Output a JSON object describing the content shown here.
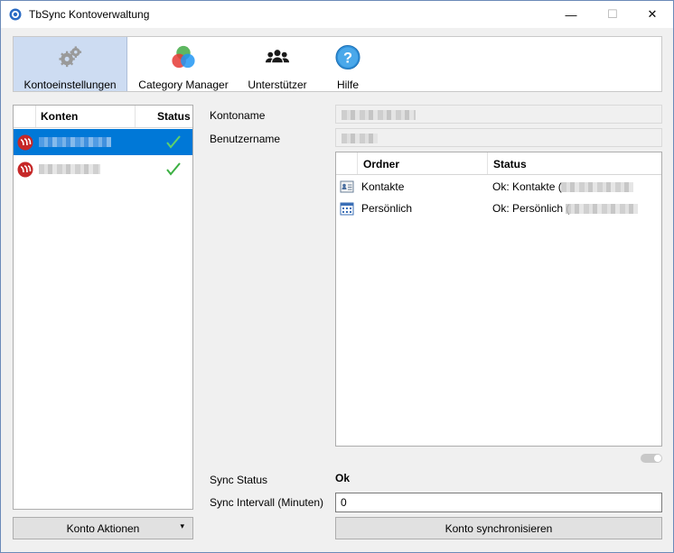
{
  "window": {
    "title": "TbSync Kontoverwaltung",
    "minimize_glyph": "—",
    "maximize_glyph": "☐",
    "close_glyph": "✕"
  },
  "toolbar": {
    "items": [
      {
        "label": "Kontoeinstellungen",
        "icon": "gears-icon",
        "active": true
      },
      {
        "label": "Category Manager",
        "icon": "color-circles-icon",
        "active": false
      },
      {
        "label": "Unterstützer",
        "icon": "people-icon",
        "active": false
      },
      {
        "label": "Hilfe",
        "icon": "help-icon",
        "active": false
      }
    ]
  },
  "accounts": {
    "columns": [
      "Konten",
      "Status"
    ],
    "rows": [
      {
        "icon": "provider-logo-icon",
        "name": "",
        "status_icon": "check-icon",
        "selected": true
      },
      {
        "icon": "provider-logo-icon",
        "name": "",
        "status_icon": "check-icon",
        "selected": false
      }
    ],
    "actions_label": "Konto Aktionen",
    "actions_dropdown_glyph": "▾"
  },
  "details": {
    "kontoname_label": "Kontoname",
    "kontoname_value": "",
    "benutzername_label": "Benutzername",
    "benutzername_value": "",
    "folders": {
      "columns": [
        "Ordner",
        "Status"
      ],
      "rows": [
        {
          "icon": "contacts-icon",
          "name": "Kontakte",
          "status": "Ok: Kontakte ("
        },
        {
          "icon": "calendar-icon",
          "name": "Persönlich",
          "status": "Ok: Persönlich ("
        }
      ]
    },
    "sync_status_label": "Sync Status",
    "sync_status_value": "Ok",
    "sync_interval_label": "Sync Intervall (Minuten)",
    "sync_interval_value": "0",
    "sync_button_label": "Konto synchronisieren"
  },
  "colors": {
    "selection": "#0078d7",
    "toolbar_active": "#cddcf2",
    "check": "#3cb043"
  }
}
